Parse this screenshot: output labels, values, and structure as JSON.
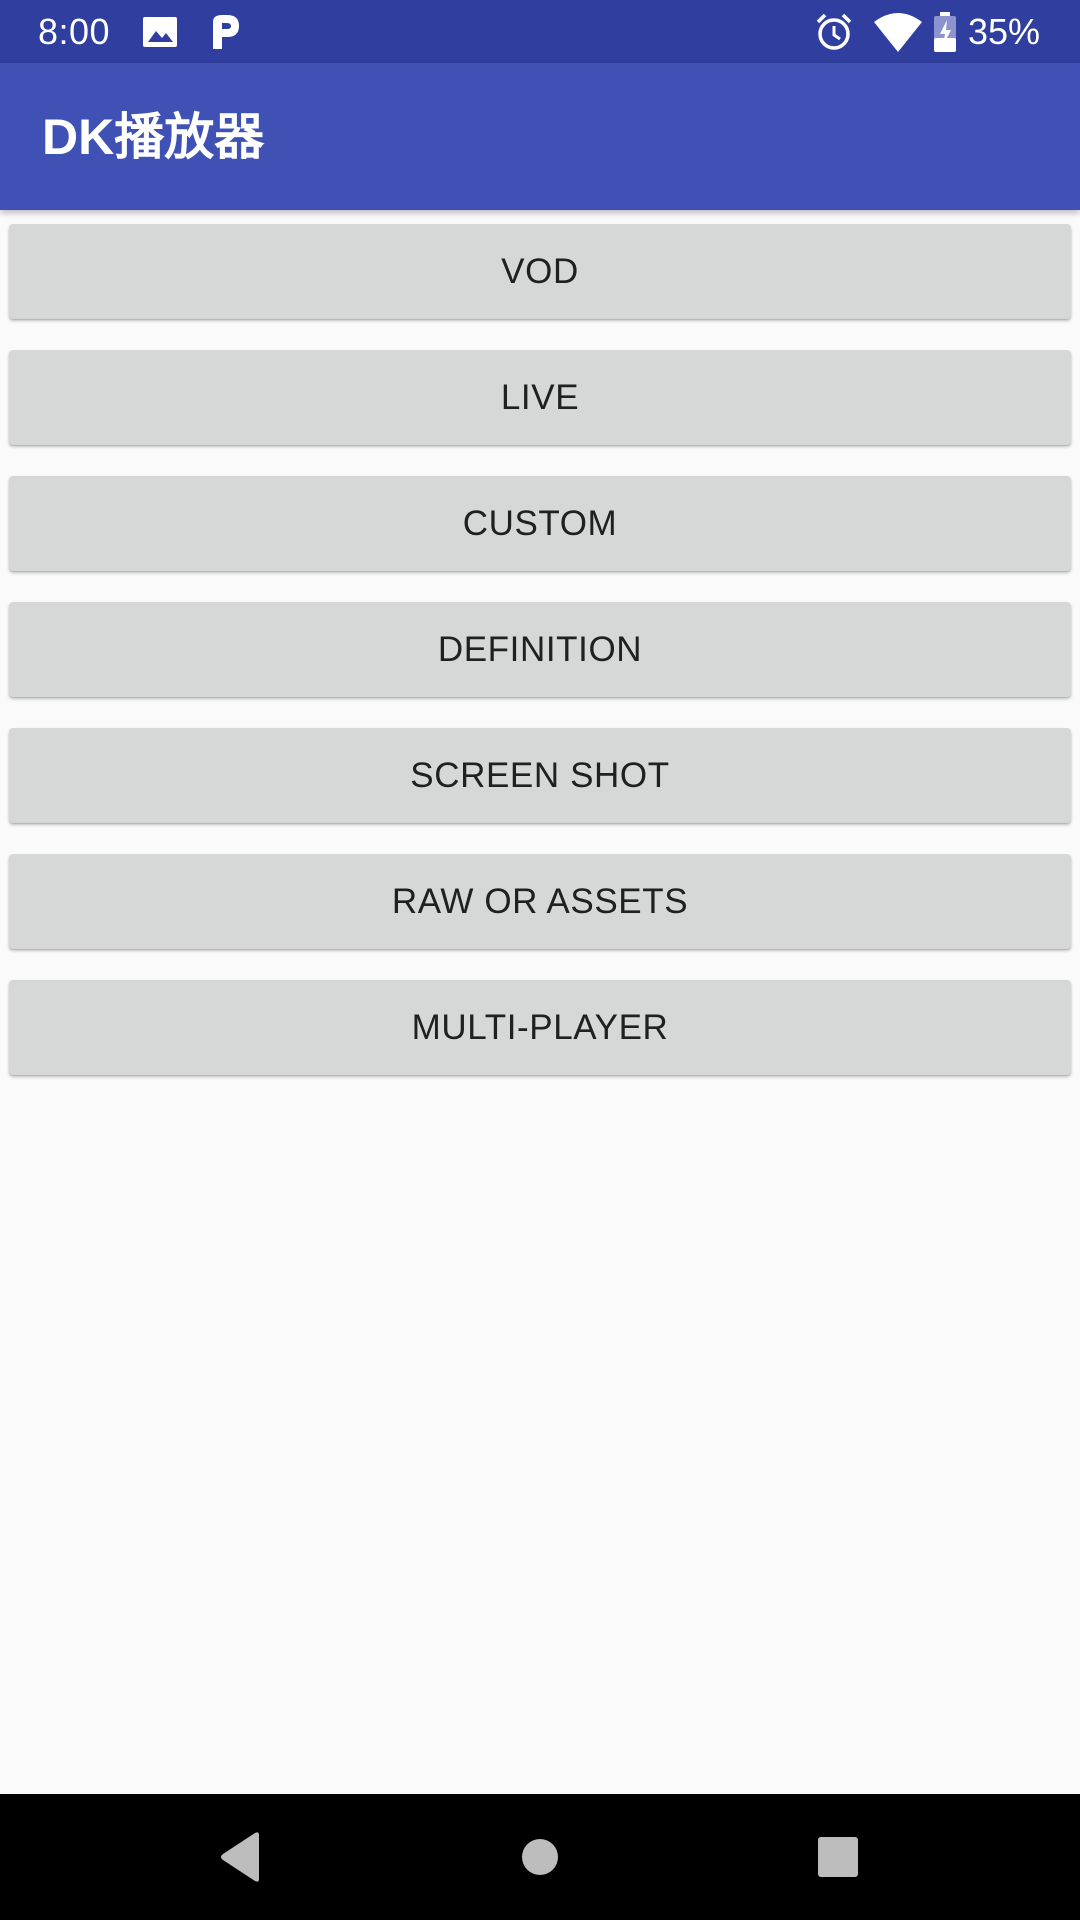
{
  "status_bar": {
    "time": "8:00",
    "battery": "35%",
    "icons": [
      "image-icon",
      "parking-icon",
      "alarm-icon",
      "wifi-icon",
      "battery-icon"
    ]
  },
  "app_bar": {
    "title": "DK播放器"
  },
  "buttons": [
    {
      "label": "VOD"
    },
    {
      "label": "LIVE"
    },
    {
      "label": "CUSTOM"
    },
    {
      "label": "DEFINITION"
    },
    {
      "label": "SCREEN SHOT"
    },
    {
      "label": "RAW OR ASSETS"
    },
    {
      "label": "MULTI-PLAYER"
    }
  ],
  "nav_bar": {
    "icons": [
      "back-icon",
      "home-icon",
      "recents-icon"
    ]
  },
  "colors": {
    "status_bar": "#303f9f",
    "app_bar": "#3f51b5",
    "button": "#d6d7d7",
    "background": "#fafafa"
  }
}
